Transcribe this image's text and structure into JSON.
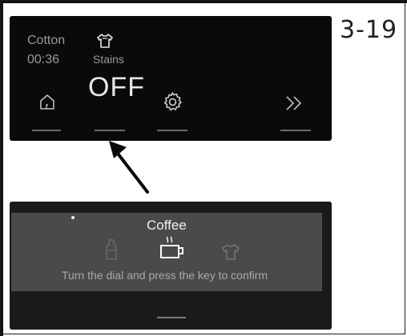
{
  "figure": {
    "number": "3-19"
  },
  "panel_top": {
    "program": "Cotton",
    "time": "00:36",
    "option_label": "Stains",
    "option_value": "OFF",
    "icons": {
      "option": "shirt-icon",
      "home": "home-icon",
      "settings": "gear-icon",
      "next": "double-chevron-right-icon"
    },
    "touch_bars": 4
  },
  "panel_bottom": {
    "title": "Coffee",
    "instruction": "Turn the dial and press the key to confirm",
    "icons": [
      "bottle-icon",
      "coffee-cup-icon",
      "shirt-icon"
    ],
    "selected_icon": "coffee-cup-icon"
  },
  "colors": {
    "panel_top_bg": "#0a0a0a",
    "panel_bottom_bg": "#1b1b1b",
    "panel_bottom_band": "#4a4a4a",
    "text_dim": "#9a9a9a",
    "text_bright": "#f0f0f0"
  }
}
